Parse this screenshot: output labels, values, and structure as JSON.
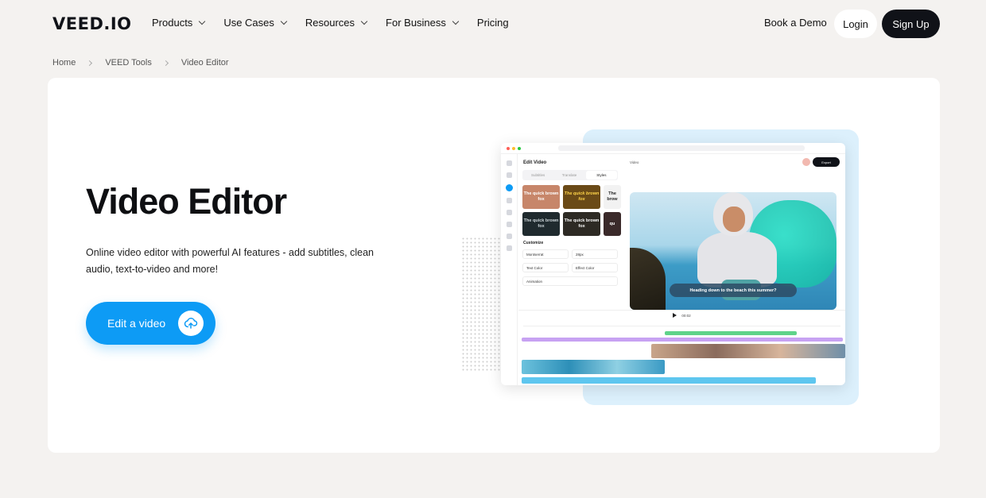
{
  "brand": {
    "logo": "VEED.IO"
  },
  "nav": {
    "items": [
      {
        "label": "Products"
      },
      {
        "label": "Use Cases"
      },
      {
        "label": "Resources"
      },
      {
        "label": "For Business"
      },
      {
        "label": "Pricing"
      }
    ],
    "book_demo": "Book a Demo",
    "login": "Login",
    "signup": "Sign Up"
  },
  "breadcrumb": [
    "Home",
    "VEED Tools",
    "Video Editor"
  ],
  "hero": {
    "title": "Video Editor",
    "description": "Online video editor with powerful AI features - add subtitles, clean audio, text-to-video and more!",
    "cta_label": "Edit a video",
    "cta_icon": "upload-cloud-icon"
  },
  "mockup": {
    "panel_title": "Edit Video",
    "tabs": [
      "Subtitles",
      "Translate",
      "Styles"
    ],
    "style_samples": [
      {
        "text": "The quick brown fox",
        "color": "#c7866a"
      },
      {
        "text": "The quick brown fox",
        "color": "#6a4a17"
      },
      {
        "text": "The brow",
        "color": "#f2f2f2"
      },
      {
        "text": "The quick brown fox",
        "color": "#1f2a2e"
      },
      {
        "text": "The quick brown fox",
        "color": "#2d2a24"
      },
      {
        "text": "qu",
        "color": "#3a2a2a"
      }
    ],
    "customize_label": "Customize",
    "font": "Montserrat",
    "font_size": "28px",
    "text_color_label": "Text Color",
    "effect_color_label": "Effect Color",
    "animation_label": "Animation",
    "preview_label": "Video",
    "export_label": "Export",
    "caption": "Heading down to the beach this summer?",
    "time": "00:02"
  }
}
